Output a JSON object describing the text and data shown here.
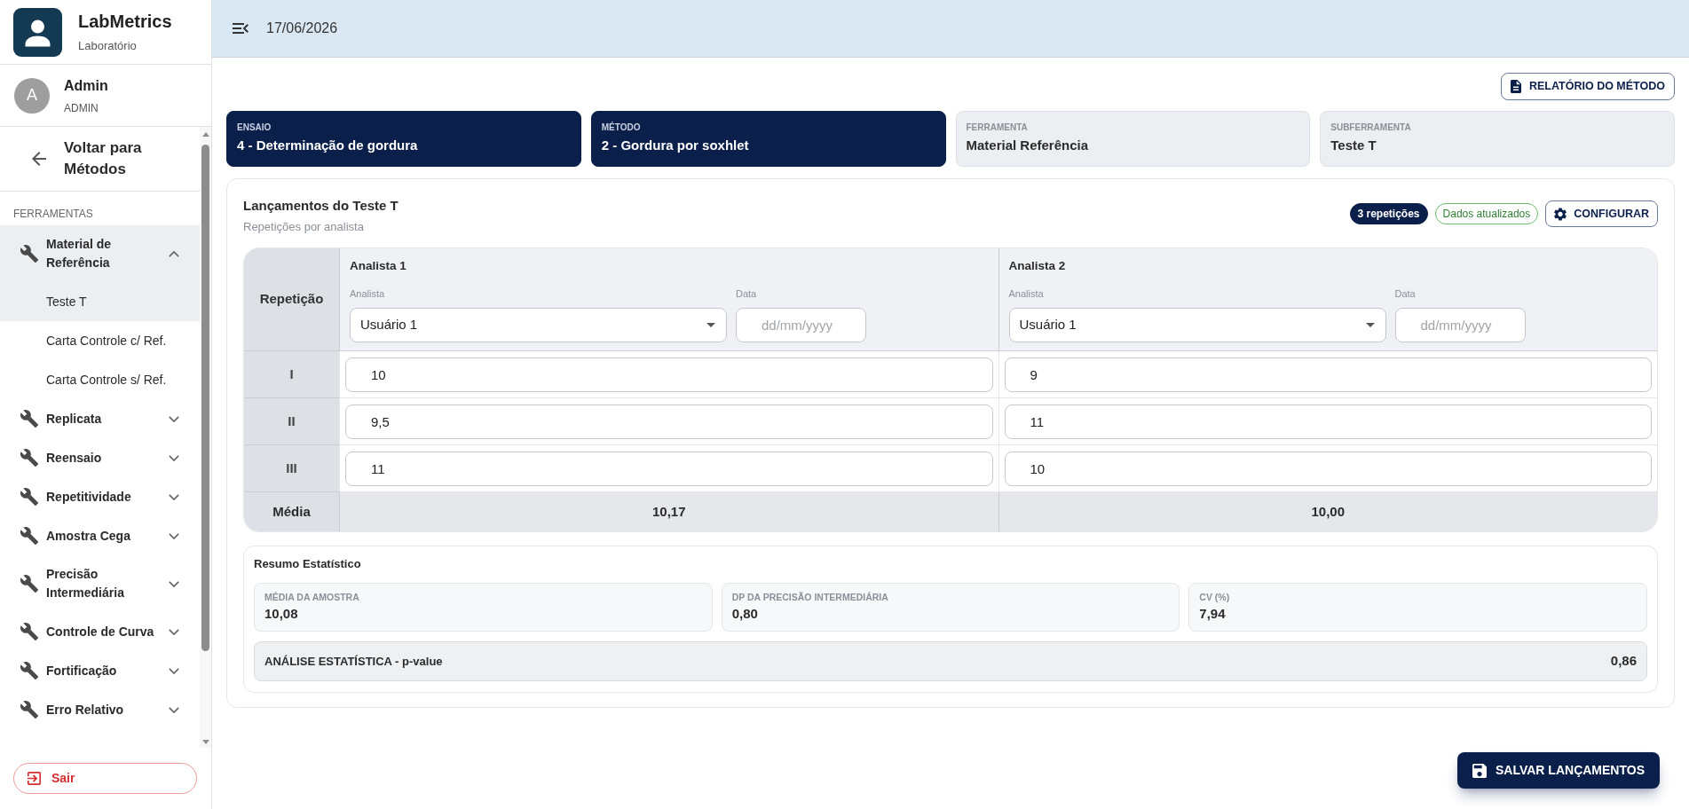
{
  "sidebar": {
    "brand": {
      "name": "LabMetrics",
      "subtitle": "Laboratório"
    },
    "user": {
      "initial": "A",
      "name": "Admin",
      "role": "ADMIN"
    },
    "back_link": "Voltar para Métodos",
    "section_title": "FERRAMENTAS",
    "tools": [
      {
        "label": "Material de Referência",
        "selected": true,
        "expanded": true,
        "children": [
          {
            "label": "Teste T",
            "selected": true
          },
          {
            "label": "Carta Controle c/ Ref.",
            "selected": false
          },
          {
            "label": "Carta Controle s/ Ref.",
            "selected": false
          }
        ]
      },
      {
        "label": "Replicata",
        "selected": false,
        "expanded": false
      },
      {
        "label": "Reensaio",
        "selected": false,
        "expanded": false
      },
      {
        "label": "Repetitividade",
        "selected": false,
        "expanded": false
      },
      {
        "label": "Amostra Cega",
        "selected": false,
        "expanded": false
      },
      {
        "label": "Precisão Intermediária",
        "selected": false,
        "expanded": false
      },
      {
        "label": "Controle de Curva",
        "selected": false,
        "expanded": false
      },
      {
        "label": "Fortificação",
        "selected": false,
        "expanded": false
      },
      {
        "label": "Erro Relativo",
        "selected": false,
        "expanded": false
      }
    ],
    "logout_button": "Sair"
  },
  "top_bar": {
    "date": "17/06/2026"
  },
  "report_button": "RELATÓRIO DO MÉTODO",
  "context_cards": [
    {
      "label": "ENSAIO",
      "value": "4 - Determinação de gordura",
      "active": true
    },
    {
      "label": "MÉTODO",
      "value": "2 - Gordura por soxhlet",
      "active": true
    },
    {
      "label": "FERRAMENTA",
      "value": "Material Referência",
      "active": false
    },
    {
      "label": "SUBFERRAMENTA",
      "value": "Teste T",
      "active": false
    }
  ],
  "entries": {
    "title": "Lançamentos do Teste T",
    "subtitle": "Repetições por analista",
    "badges": [
      {
        "kind": "count",
        "text": "3 repetições"
      },
      {
        "kind": "status",
        "text": "Dados atualizados"
      }
    ],
    "configure_button": "CONFIGURAR",
    "table": {
      "row_header": "Repetição",
      "rows": [
        "I",
        "II",
        "III"
      ],
      "mean_label": "Média",
      "analysts": [
        {
          "title": "Analista 1",
          "analyst_label": "Analista",
          "analyst_value": "Usuário 1",
          "date_label": "Data",
          "date_placeholder": "dd/mm/yyyy",
          "values": [
            "10",
            "9,5",
            "11"
          ],
          "mean": "10,17"
        },
        {
          "title": "Analista 2",
          "analyst_label": "Analista",
          "analyst_value": "Usuário 1",
          "date_label": "Data",
          "date_placeholder": "dd/mm/yyyy",
          "values": [
            "9",
            "11",
            "10"
          ],
          "mean": "10,00"
        }
      ]
    }
  },
  "statistics": {
    "title": "Resumo Estatístico",
    "metrics": [
      {
        "label": "MÉDIA DA AMOSTRA",
        "value": "10,08"
      },
      {
        "label": "DP DA PRECISÃO INTERMEDIÁRIA",
        "value": "0,80"
      },
      {
        "label": "CV (%)",
        "value": "7,94"
      }
    ],
    "analysis": {
      "label": "ANÁLISE ESTATÍSTICA - p-value",
      "value": "0,86"
    }
  },
  "save_button": "SALVAR LANÇAMENTOS"
}
